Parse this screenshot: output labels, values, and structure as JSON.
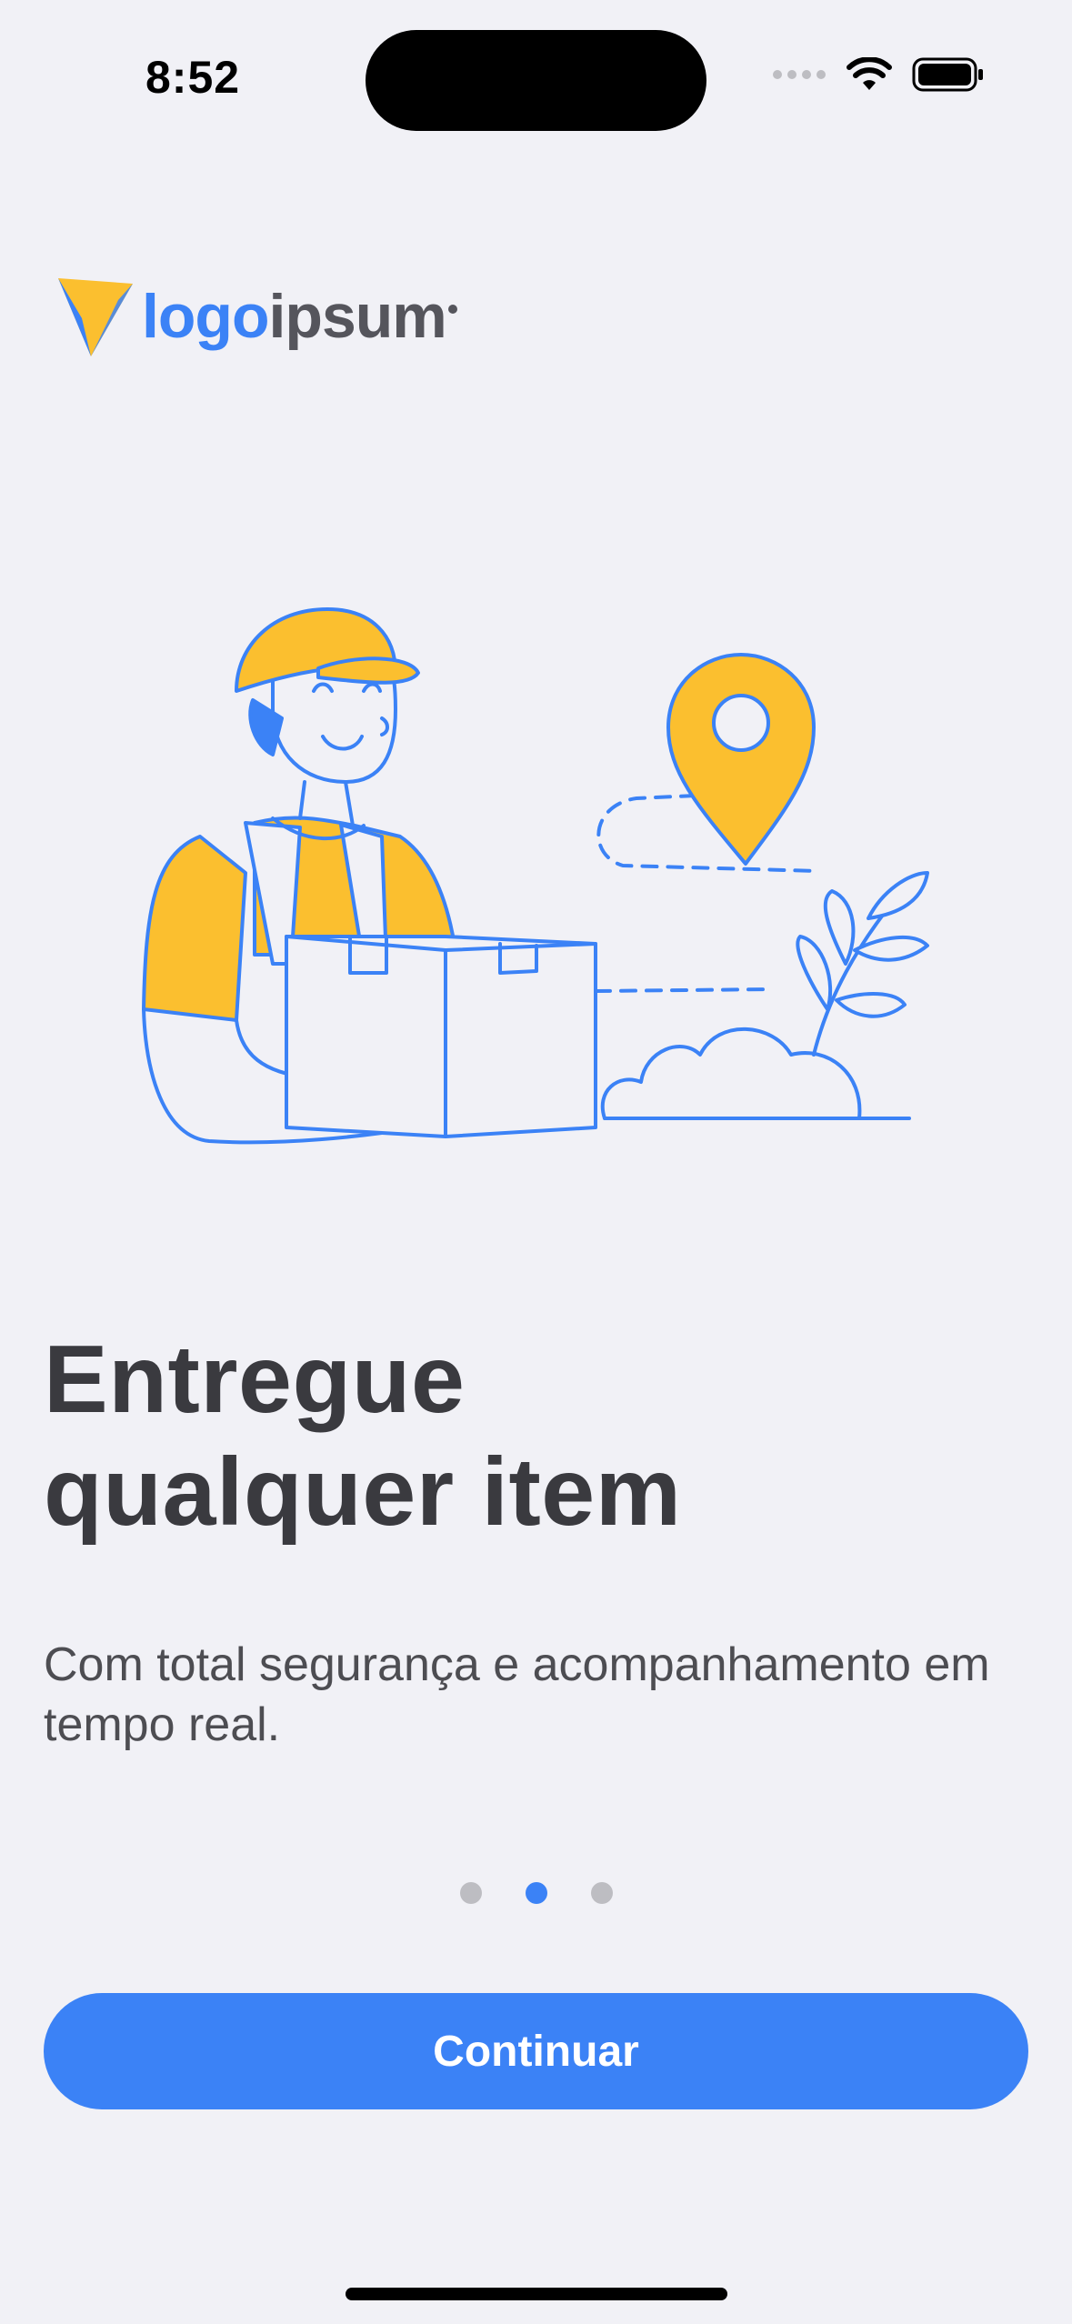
{
  "status_bar": {
    "time": "8:52",
    "icons": [
      "cellular-signal-icon",
      "wifi-icon",
      "battery-icon"
    ]
  },
  "logo": {
    "part1": "logo",
    "part2": "ipsum",
    "icon": "triangle-logo-icon"
  },
  "illustration": {
    "name": "delivery-person-illustration",
    "colors": {
      "accent": "#FBBF2F",
      "line": "#3B82F6"
    }
  },
  "onboarding": {
    "title_line1": "Entregue",
    "title_line2": "qualquer item",
    "subtitle": "Com total segurança e acompanhamento em tempo real.",
    "pages": 3,
    "active_page": 2
  },
  "cta": {
    "label": "Continuar"
  },
  "colors": {
    "background": "#F1F1F6",
    "primary": "#3B82F6",
    "accent": "#FBBF2F",
    "title": "#3A3A3F"
  }
}
